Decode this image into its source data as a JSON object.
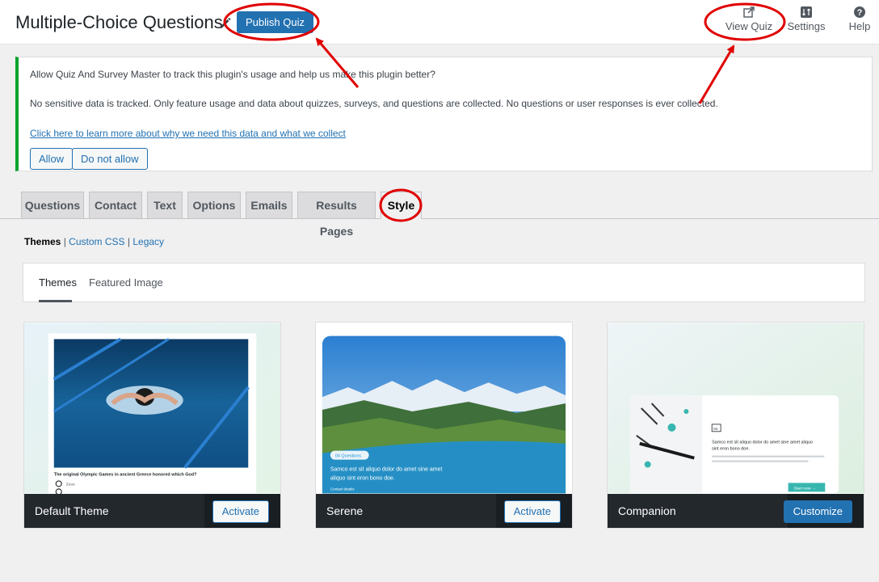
{
  "header": {
    "title": "Multiple-Choice Questions",
    "publish_label": "Publish Quiz",
    "actions": [
      {
        "label": "View Quiz",
        "icon": "external-link-icon"
      },
      {
        "label": "Settings",
        "icon": "settings-icon"
      },
      {
        "label": "Help",
        "icon": "help-icon"
      }
    ]
  },
  "notice": {
    "line1": "Allow Quiz And Survey Master to track this plugin's usage and help us make this plugin better?",
    "line2": "No sensitive data is tracked. Only feature usage and data about quizzes, surveys, and questions are collected. No questions or user responses is ever collected.",
    "link": "Click here to learn more about why we need this data and what we collect",
    "allow": "Allow",
    "deny": "Do not allow",
    "accent_color": "#00a32a"
  },
  "tabs": [
    {
      "label": "Questions"
    },
    {
      "label": "Contact"
    },
    {
      "label": "Text"
    },
    {
      "label": "Options"
    },
    {
      "label": "Emails"
    },
    {
      "label": "Results Pages"
    },
    {
      "label": "Style",
      "active": true
    }
  ],
  "subnav": {
    "current": "Themes",
    "sep": "|",
    "custom_css": "Custom CSS",
    "legacy": "Legacy"
  },
  "panel_tabs": {
    "themes": "Themes",
    "featured": "Featured Image"
  },
  "themes": [
    {
      "name": "Default Theme",
      "button": "Activate",
      "preview_question": "The original Olympic Games in ancient Greece honored which God?",
      "preview_option": "Zeus"
    },
    {
      "name": "Serene",
      "button": "Activate",
      "preview_badge": "04 Questions",
      "preview_text": "Samco est sit aliquo dolor do amet sine amet",
      "preview_text2": "aliquo sint eron bono doe.",
      "preview_contact": "Contact details"
    },
    {
      "name": "Companion",
      "button": "Customize",
      "preview_badge": "04",
      "preview_text": "Samco est sit aliquo dolor do amet sine amet aliquo",
      "preview_text2": "sint eron bono doe.",
      "preview_btn": "Start now →"
    }
  ],
  "colors": {
    "brand": "#2271b1",
    "annotation": "#e00000"
  }
}
